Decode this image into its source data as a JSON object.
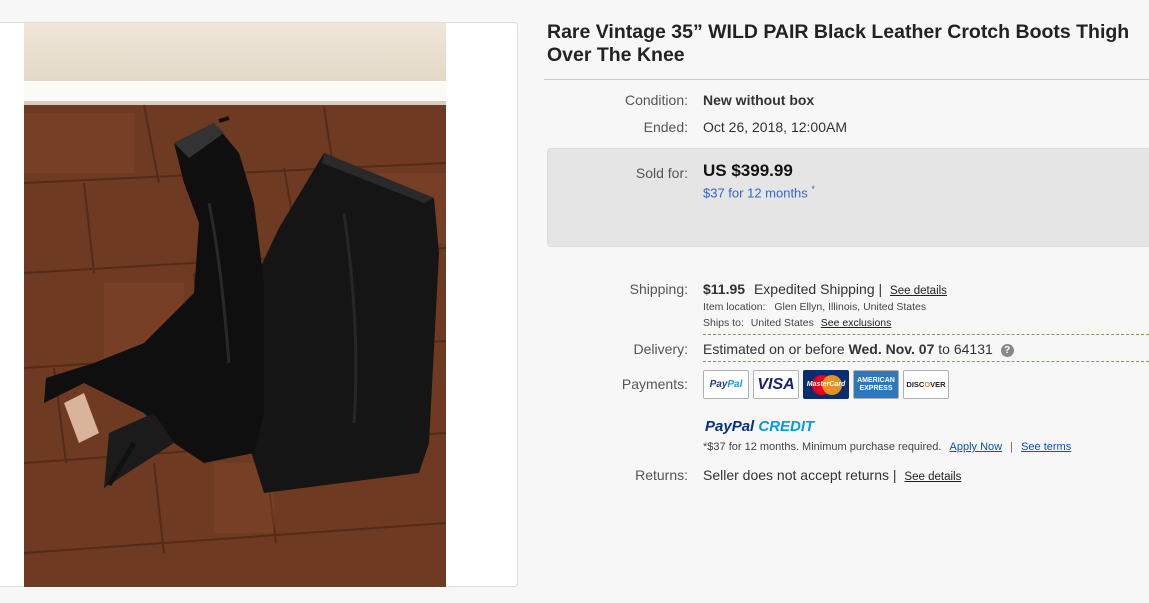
{
  "listing": {
    "title_line1": "Rare Vintage 35” WILD PAIR Black Leather Crotch Boots Thigh",
    "title_line2": "Over The Knee"
  },
  "condition": {
    "label": "Condition:",
    "value": "New without box"
  },
  "ended": {
    "label": "Ended:",
    "value": "Oct 26, 2018, 12:00AM"
  },
  "sold": {
    "label": "Sold for:",
    "price": "US $399.99",
    "monthly": "$37 for 12 months",
    "monthly_mark": "*"
  },
  "shipping": {
    "label": "Shipping:",
    "cost": "$11.95",
    "method": "Expedited Shipping |",
    "details_link": "See details",
    "item_location_label": "Item location:",
    "item_location": "Glen Ellyn, Illinois, United States",
    "ships_to_label": "Ships to:",
    "ships_to": "United States",
    "exclusions_link": "See exclusions"
  },
  "delivery": {
    "label": "Delivery:",
    "prefix": "Estimated on or before",
    "date": "Wed. Nov. 07",
    "to": "to 64131",
    "help_icon": "?"
  },
  "payments": {
    "label": "Payments:",
    "cards": [
      "PayPal",
      "VISA",
      "MasterCard",
      "AMERICAN EXPRESS",
      "DISCOVER"
    ],
    "paypal_credit_a": "PayPal",
    "paypal_credit_b": " CREDIT",
    "credit_note": "*$37 for 12 months. Minimum purchase required.",
    "apply_link": "Apply Now",
    "separator": "|",
    "terms_link": "See terms"
  },
  "returns": {
    "label": "Returns:",
    "value": "Seller does not accept returns |",
    "details_link": "See details"
  },
  "colors": {
    "link_blue": "#0654ba",
    "price_box": "#e5e5e5",
    "dashed_green": "#7ba05b"
  }
}
